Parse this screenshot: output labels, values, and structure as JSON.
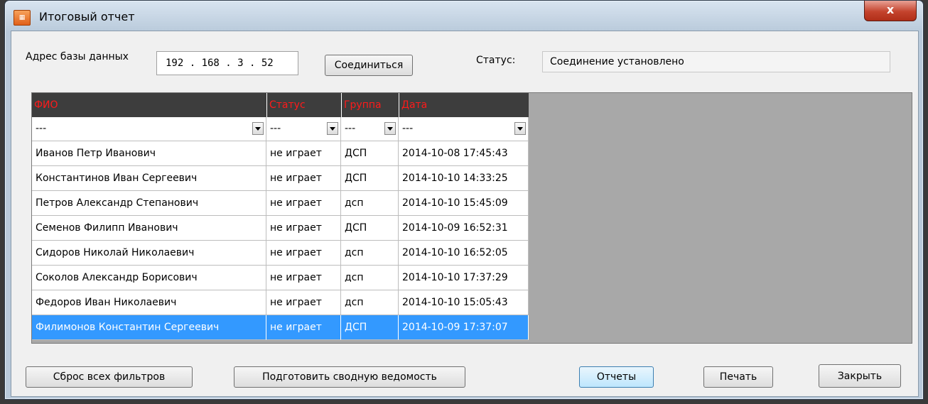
{
  "window": {
    "title": "Итоговый отчет",
    "close_label": "x"
  },
  "connection": {
    "db_address_label": "Адрес базы данных",
    "db_address_value": "192 . 168 .  3  . 52",
    "connect_label": "Соединиться",
    "status_label": "Статус:",
    "status_value": "Соединение установлено"
  },
  "table": {
    "columns": [
      "ФИО",
      "Статус",
      "Группа",
      "Дата"
    ],
    "filters": [
      "---",
      "---",
      "---",
      "---"
    ],
    "selected_row": 7,
    "rows": [
      [
        "Иванов Петр Иванович",
        "не играет",
        "ДСП",
        "2014-10-08 17:45:43"
      ],
      [
        "Константинов Иван Сергеевич",
        "не играет",
        "ДСП",
        "2014-10-10 14:33:25"
      ],
      [
        "Петров Александр Степанович",
        "не играет",
        "дсп",
        "2014-10-10 15:45:09"
      ],
      [
        "Семенов Филипп Иванович",
        "не играет",
        "ДСП",
        "2014-10-09 16:52:31"
      ],
      [
        "Сидоров Николай Николаевич",
        "не играет",
        "дсп",
        "2014-10-10 16:52:05"
      ],
      [
        "Соколов Александр Борисович",
        "не играет",
        "дсп",
        "2014-10-10 17:37:29"
      ],
      [
        "Федоров Иван Николаевич",
        "не играет",
        "дсп",
        "2014-10-10 15:05:43"
      ],
      [
        "Филимонов Константин Сергеевич",
        "не играет",
        "ДСП",
        "2014-10-09 17:37:07"
      ]
    ]
  },
  "buttons": {
    "reset_filters": "Сброс всех фильтров",
    "prepare_summary": "Подготовить сводную ведомость",
    "reports": "Отчеты",
    "print": "Печать",
    "close": "Закрыть"
  },
  "colors": {
    "header_bg": "#3d3d3d",
    "header_text": "#ff1a1a",
    "selection": "#3399ff"
  }
}
